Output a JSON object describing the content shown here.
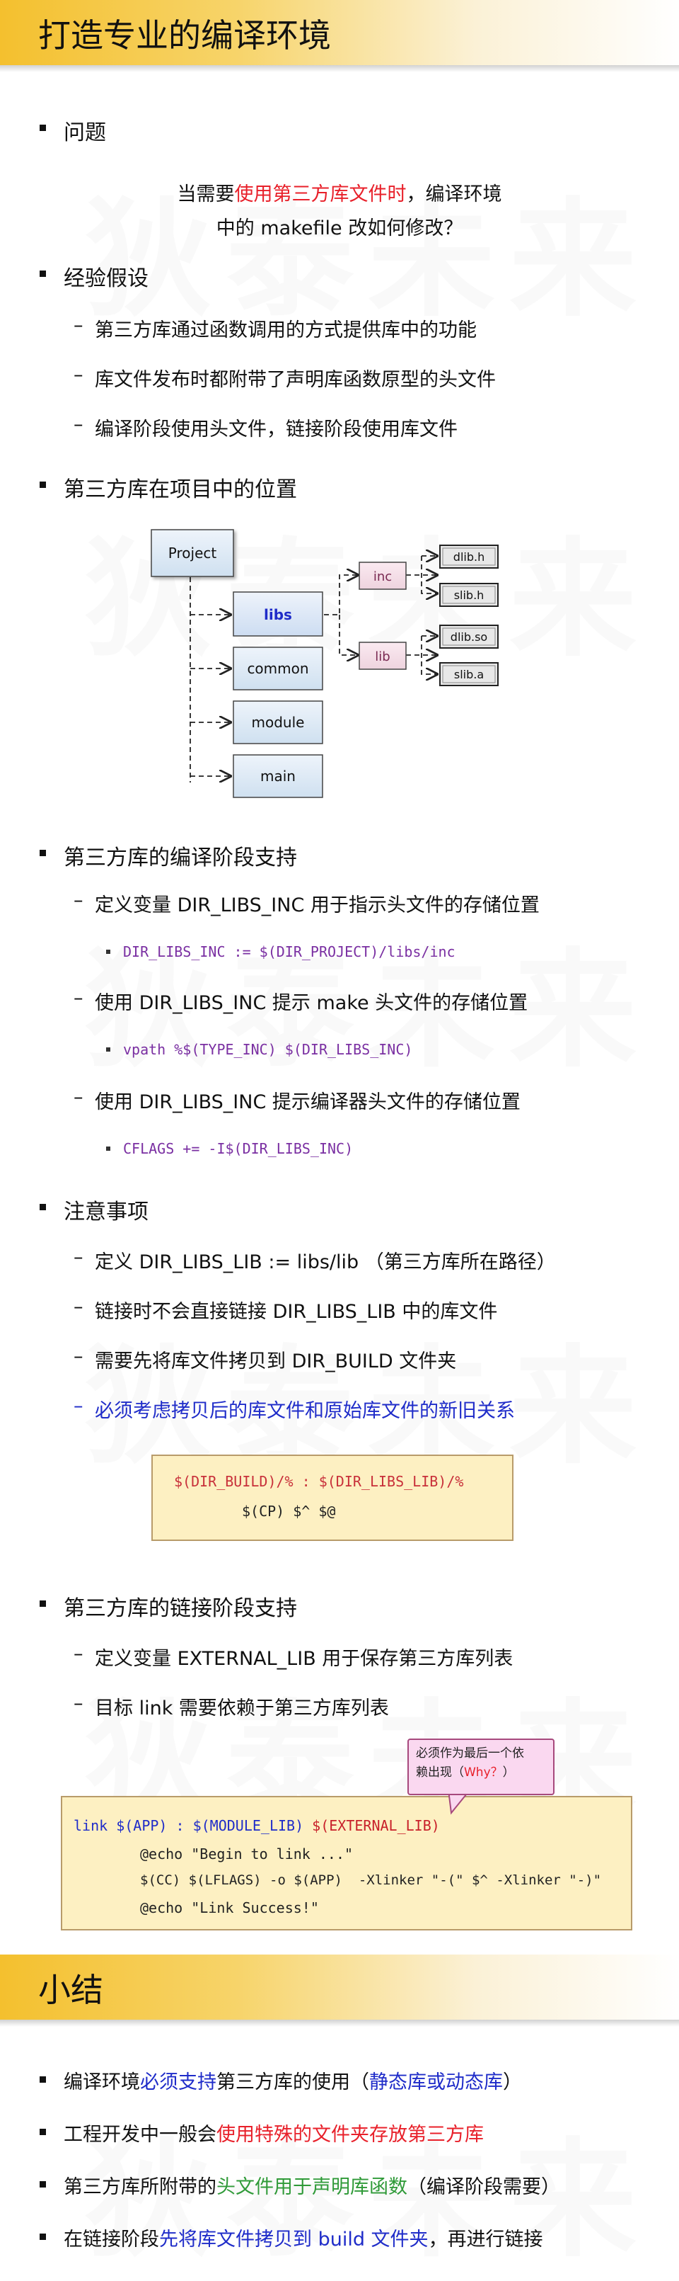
{
  "watermark": "狄泰未来",
  "section1": {
    "title": "打造专业的编译环境"
  },
  "problem": {
    "heading": "问题",
    "q_line1_pre": "当需要",
    "q_line1_red": "使用第三方库文件时",
    "q_line1_post": "，编译环境",
    "q_line2": "中的 makefile 改如何修改？"
  },
  "assumptions": {
    "heading": "经验假设",
    "items": [
      "第三方库通过函数调用的方式提供库中的功能",
      "库文件发布时都附带了声明库函数原型的头文件",
      "编译阶段使用头文件，链接阶段使用库文件"
    ]
  },
  "position": {
    "heading": "第三方库在项目中的位置",
    "diagram": {
      "project": "Project",
      "libs": "libs",
      "common": "common",
      "module": "module",
      "main": "main",
      "inc": "inc",
      "lib": "lib",
      "dlib_h": "dlib.h",
      "slib_h": "slib.h",
      "dlib_so": "dlib.so",
      "slib_a": "slib.a"
    }
  },
  "compile": {
    "heading": "第三方库的编译阶段支持",
    "items": [
      {
        "text": "定义变量 DIR_LIBS_INC 用于指示头文件的存储位置",
        "code": "DIR_LIBS_INC := $(DIR_PROJECT)/libs/inc"
      },
      {
        "text": "使用 DIR_LIBS_INC 提示 make 头文件的存储位置",
        "code": "vpath %$(TYPE_INC) $(DIR_LIBS_INC)"
      },
      {
        "text": "使用 DIR_LIBS_INC 提示编译器头文件的存储位置",
        "code": "CFLAGS += -I$(DIR_LIBS_INC)"
      }
    ]
  },
  "notes": {
    "heading": "注意事项",
    "items": [
      "定义 DIR_LIBS_LIB := libs/lib （第三方库所在路径）",
      "链接时不会直接链接 DIR_LIBS_LIB 中的库文件",
      "需要先将库文件拷贝到 DIR_BUILD 文件夹",
      "必须考虑拷贝后的库文件和原始库文件的新旧关系"
    ],
    "code_line1": "$(DIR_BUILD)/% : $(DIR_LIBS_LIB)/%",
    "code_line2": "$(CP) $^ $@"
  },
  "link": {
    "heading": "第三方库的链接阶段支持",
    "items": [
      "定义变量 EXTERNAL_LIB 用于保存第三方库列表",
      "目标 link 需要依赖于第三方库列表"
    ],
    "callout_line1": "必须作为最后一个依",
    "callout_line2_pre": "赖出现（",
    "callout_line2_red": "Why？",
    "callout_line2_post": "）",
    "code_l1_pre": "link $(APP) : $(MODULE_LIB) ",
    "code_l1_red": "$(EXTERNAL_LIB)",
    "code_l2": "@echo \"Begin to link ...\"",
    "code_l3": "$(CC) $(LFLAGS) -o $(APP)  -Xlinker \"-(\" $^ -Xlinker \"-)\"",
    "code_l4": "@echo \"Link Success!\""
  },
  "section2": {
    "title": "小结"
  },
  "summary": {
    "i1_a": "编译环境",
    "i1_b": "必须支持",
    "i1_c": "第三方库的使用（",
    "i1_d": "静态库或动态库",
    "i1_e": "）",
    "i2_a": "工程开发中一般会",
    "i2_b": "使用特殊的文件夹存放第三方库",
    "i3_a": "第三方库所附带的",
    "i3_b": "头文件用于声明库函数",
    "i3_c": "（编译阶段需要）",
    "i4_a": "在链接阶段",
    "i4_b": "先将库文件拷贝到 build 文件夹",
    "i4_c": "，再进行链接"
  },
  "colors": {
    "banner": "#f4c02e",
    "red": "#e8202a",
    "blue": "#1f2cc9",
    "green": "#2f9a38",
    "code_bg": "#fdf0c2"
  }
}
